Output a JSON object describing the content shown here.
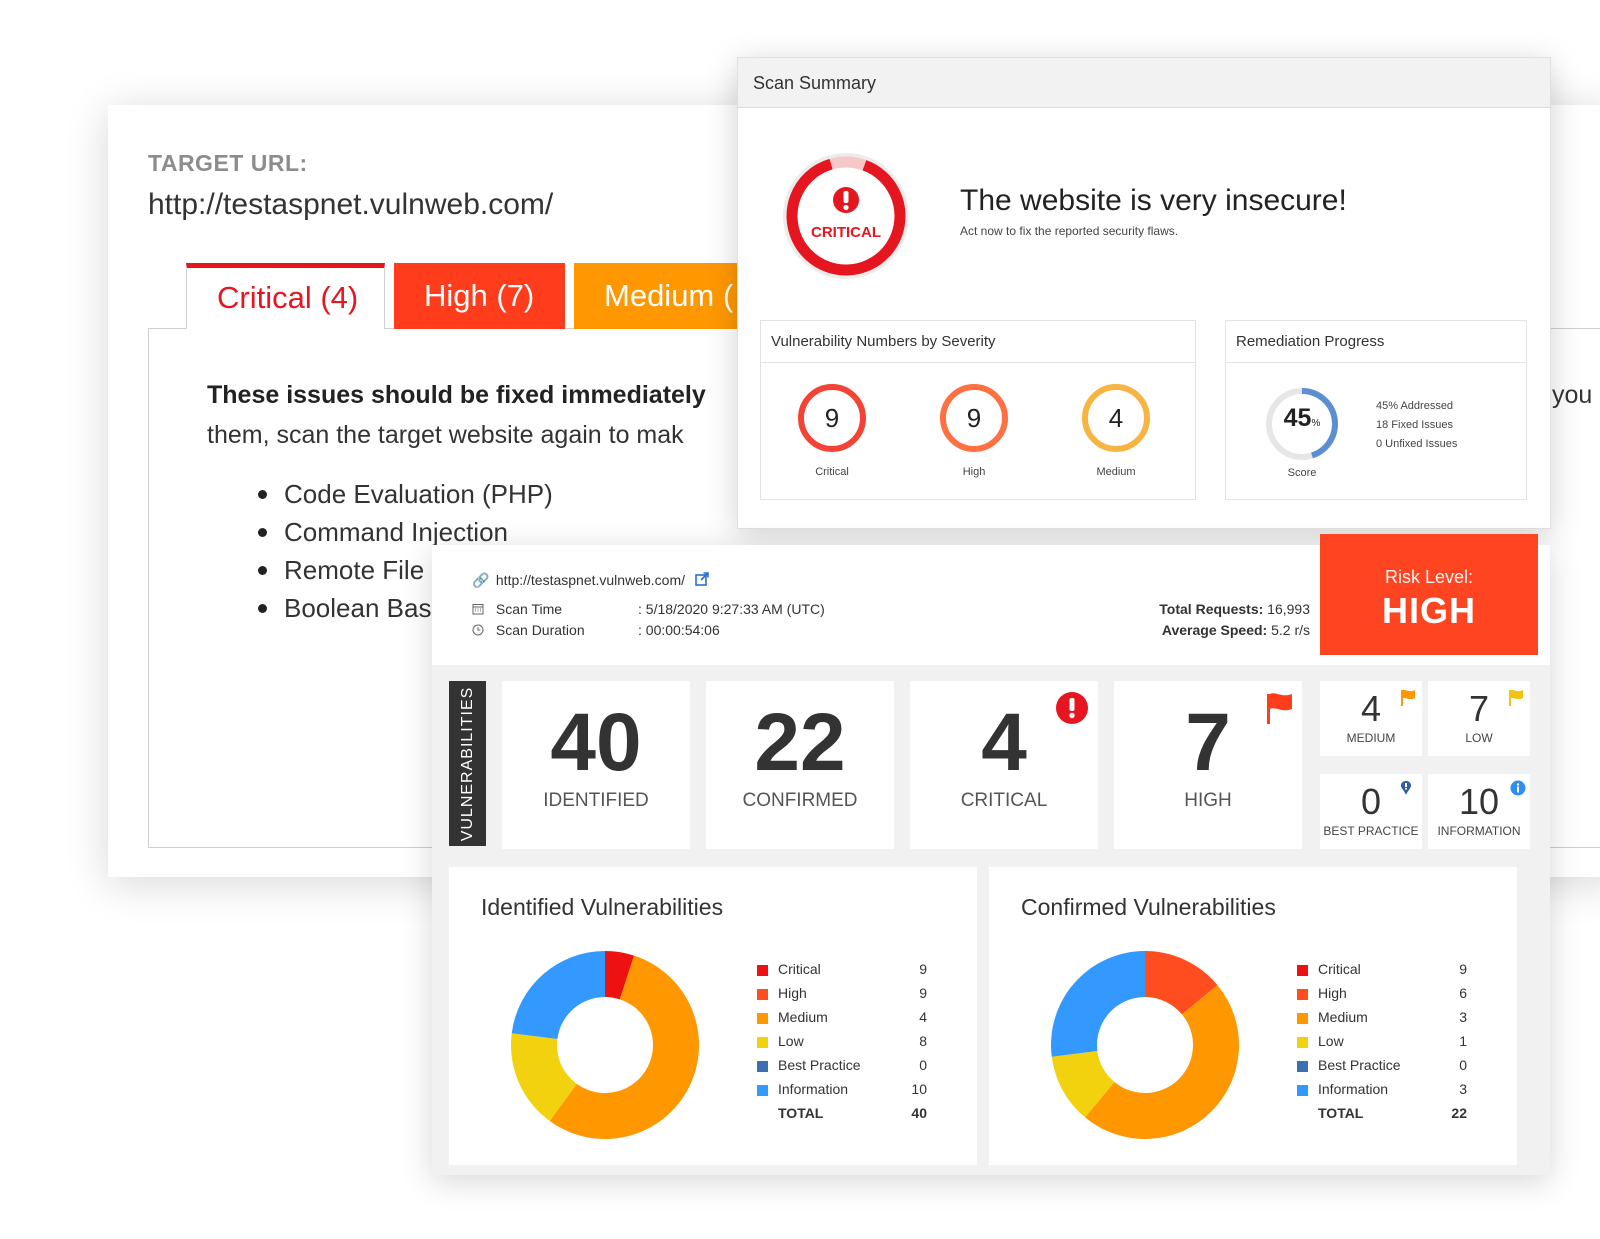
{
  "target": {
    "label": "TARGET URL:",
    "url": "http://testaspnet.vulnweb.com/"
  },
  "tabs": [
    {
      "label": "Critical (4)",
      "color": "#e5161f"
    },
    {
      "label": "High (7)",
      "color": "#ff3c1c"
    },
    {
      "label": "Medium (",
      "color": "#ff9800"
    }
  ],
  "issues": {
    "bold_text": "These issues should be fixed immediately",
    "text": "them, scan the target website again to mak",
    "trailing_text": "you",
    "list": [
      "Code Evaluation (PHP)",
      "Command Injection",
      "Remote File",
      "Boolean Bas"
    ]
  },
  "scan_summary": {
    "header": "Scan Summary",
    "badge": "CRITICAL",
    "title": "The website is very insecure!",
    "subtitle": "Act now to fix the reported security flaws.",
    "severity_box": {
      "title": "Vulnerability Numbers by Severity",
      "items": [
        {
          "value": "9",
          "label": "Critical",
          "color": "#f44336"
        },
        {
          "value": "9",
          "label": "High",
          "color": "#ff7043"
        },
        {
          "value": "4",
          "label": "Medium",
          "color": "#f8b442"
        }
      ]
    },
    "remediation": {
      "title": "Remediation Progress",
      "score": "45",
      "score_unit": "%",
      "score_fraction": 0.45,
      "score_label": "Score",
      "lines": [
        "45% Addressed",
        "18 Fixed Issues",
        "0 Unfixed Issues"
      ]
    }
  },
  "dashboard": {
    "url": "http://testaspnet.vulnweb.com/",
    "scan_time_label": "Scan Time",
    "scan_time_value": ": 5/18/2020 9:27:33 AM (UTC)",
    "scan_duration_label": "Scan Duration",
    "scan_duration_value": ": 00:00:54:06",
    "total_requests_label": "Total Requests:",
    "total_requests_value": "16,993",
    "average_speed_label": "Average Speed:",
    "average_speed_value": "5.2 r/s",
    "risk_label": "Risk Level:",
    "risk_value": "HIGH",
    "vulnerabilities_label": "VULNERABILITIES",
    "stats": [
      {
        "value": "40",
        "label": "IDENTIFIED"
      },
      {
        "value": "22",
        "label": "CONFIRMED"
      },
      {
        "value": "4",
        "label": "CRITICAL"
      },
      {
        "value": "7",
        "label": "HIGH"
      }
    ],
    "small_stats": [
      {
        "value": "4",
        "label": "MEDIUM"
      },
      {
        "value": "7",
        "label": "LOW"
      },
      {
        "value": "0",
        "label": "BEST PRACTICE"
      },
      {
        "value": "10",
        "label": "INFORMATION"
      }
    ]
  },
  "chart_data": [
    {
      "type": "pie",
      "title": "Identified Vulnerabilities",
      "categories": [
        "Critical",
        "High",
        "Medium",
        "Low",
        "Best Practice",
        "Information"
      ],
      "values": [
        9,
        9,
        4,
        8,
        0,
        10
      ],
      "colors": [
        "#ee1111",
        "#ff4d1f",
        "#ff9800",
        "#f2d10f",
        "#3a6fb0",
        "#3399ff"
      ],
      "total_label": "TOTAL",
      "total": 40,
      "donut_arcs": [
        {
          "category": "Critical",
          "fraction": 0.05
        },
        {
          "category": "Medium",
          "fraction": 0.55
        },
        {
          "category": "Low",
          "fraction": 0.17
        },
        {
          "category": "Information",
          "fraction": 0.23
        }
      ]
    },
    {
      "type": "pie",
      "title": "Confirmed Vulnerabilities",
      "categories": [
        "Critical",
        "High",
        "Medium",
        "Low",
        "Best Practice",
        "Information"
      ],
      "values": [
        9,
        6,
        3,
        1,
        0,
        3
      ],
      "colors": [
        "#ee1111",
        "#ff4d1f",
        "#ff9800",
        "#f2d10f",
        "#3a6fb0",
        "#3399ff"
      ],
      "total_label": "TOTAL",
      "total": 22,
      "donut_arcs": [
        {
          "category": "High",
          "fraction": 0.14
        },
        {
          "category": "Medium",
          "fraction": 0.47
        },
        {
          "category": "Low",
          "fraction": 0.12
        },
        {
          "category": "Information",
          "fraction": 0.27
        }
      ]
    }
  ]
}
